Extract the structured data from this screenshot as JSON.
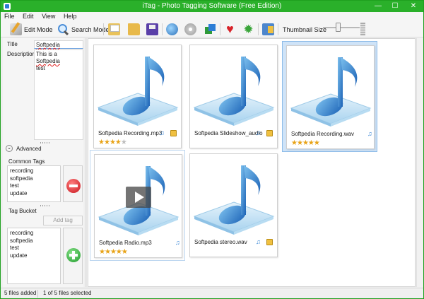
{
  "window": {
    "title": "iTag - Photo Tagging Software (Free Edition)",
    "min": "—",
    "max": "☐",
    "close": "✕"
  },
  "menu": [
    "File",
    "Edit",
    "View",
    "Help"
  ],
  "toolbar": {
    "edit_mode": "Edit Mode",
    "search_mode": "Search Mode",
    "thumbnail_size_label": "Thumbnail Size",
    "thumbnail_size_level": 0.4
  },
  "details": {
    "title_label": "Title",
    "title_value": "Softpedia",
    "description_label": "Description",
    "description_prefix": "This is a ",
    "description_word": "Softpedia",
    "description_line2": "test"
  },
  "advanced": {
    "label": "Advanced"
  },
  "common_tags": {
    "label": "Common Tags",
    "items": [
      "recording",
      "softpedia",
      "test",
      "update"
    ]
  },
  "tag_bucket": {
    "label": "Tag Bucket",
    "add_tag": "Add tag",
    "items": [
      "recording",
      "softpedia",
      "test",
      "update"
    ]
  },
  "files": [
    {
      "name": "Softpedia Recording.mp3",
      "rating": 4,
      "max": 5,
      "selected": false,
      "play": false,
      "tag_icon": true
    },
    {
      "name": "Softpedia Slideshow_audio",
      "rating": 0,
      "max": 5,
      "selected": false,
      "play": false,
      "tag_icon": true
    },
    {
      "name": "Softpedia Recording.wav",
      "rating": 5,
      "max": 5,
      "selected": true,
      "play": false,
      "tag_icon": false
    },
    {
      "name": "Softpedia Radio.mp3",
      "rating": 5,
      "max": 5,
      "selected": false,
      "play": true,
      "tag_icon": false
    },
    {
      "name": "Softpedia stereo.wav",
      "rating": 0,
      "max": 5,
      "selected": false,
      "play": false,
      "tag_icon": true
    }
  ],
  "status": {
    "files_added": "5 files added",
    "selection": "1 of 5 files selected"
  },
  "colors": {
    "titlebar": "#2ab02a",
    "selection": "#cfe3f7",
    "star": "#e8a317",
    "note": "#3a86d6"
  }
}
